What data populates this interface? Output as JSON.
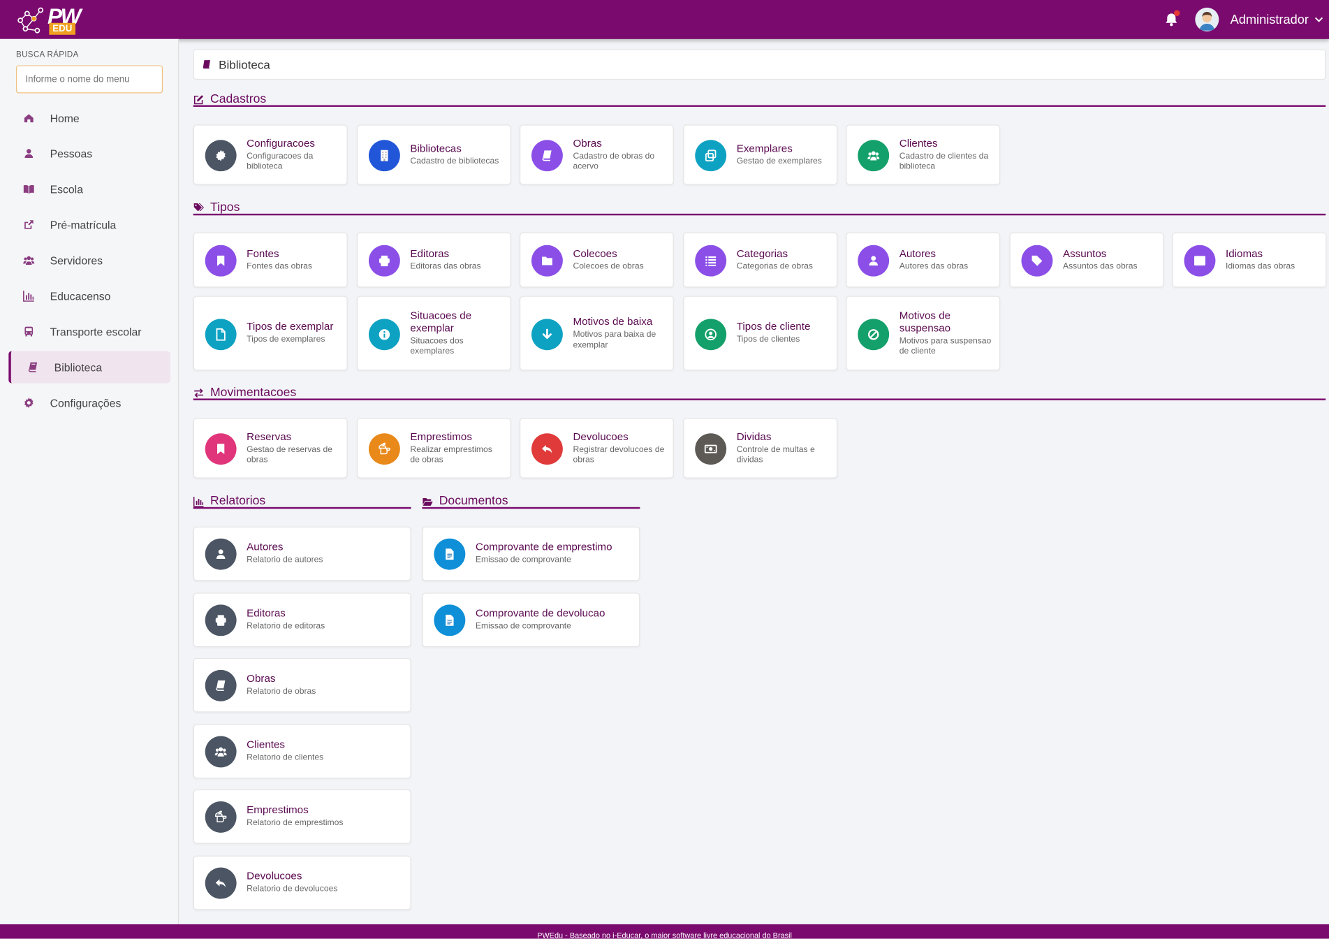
{
  "brand": {
    "name": "PW",
    "badge": "EDU"
  },
  "header": {
    "user": "Administrador"
  },
  "sidebar": {
    "busca_label": "BUSCA RÁPIDA",
    "busca_placeholder": "Informe o nome do menu",
    "items": [
      {
        "label": "Home",
        "icon": "home-icon"
      },
      {
        "label": "Pessoas",
        "icon": "person-icon"
      },
      {
        "label": "Escola",
        "icon": "book-open-icon"
      },
      {
        "label": "Pré-matrícula",
        "icon": "external-link-icon"
      },
      {
        "label": "Servidores",
        "icon": "users-icon"
      },
      {
        "label": "Educacenso",
        "icon": "bar-chart-icon"
      },
      {
        "label": "Transporte escolar",
        "icon": "bus-icon"
      },
      {
        "label": "Biblioteca",
        "icon": "book-icon",
        "active": true
      },
      {
        "label": "Configurações",
        "icon": "gear-icon"
      }
    ]
  },
  "breadcrumb": {
    "title": "Biblioteca"
  },
  "sections": {
    "cadastros": {
      "title": "Cadastros",
      "icon": "edit-icon",
      "cards": [
        {
          "title": "Configuracoes",
          "desc": "Configuracoes da biblioteca",
          "color": "#4b5563",
          "icon": "gear-icon"
        },
        {
          "title": "Bibliotecas",
          "desc": "Cadastro de bibliotecas",
          "color": "#2256d8",
          "icon": "building-icon"
        },
        {
          "title": "Obras",
          "desc": "Cadastro de obras do acervo",
          "color": "#8b4fe8",
          "icon": "book-icon"
        },
        {
          "title": "Exemplares",
          "desc": "Gestao de exemplares",
          "color": "#0ea2c2",
          "icon": "copy-icon"
        },
        {
          "title": "Clientes",
          "desc": "Cadastro de clientes da biblioteca",
          "color": "#14a06a",
          "icon": "users-icon"
        }
      ]
    },
    "tipos": {
      "title": "Tipos",
      "icon": "tags-icon",
      "cards": [
        {
          "title": "Fontes",
          "desc": "Fontes das obras",
          "color": "#8b4fe8",
          "icon": "bookmark-icon"
        },
        {
          "title": "Editoras",
          "desc": "Editoras das obras",
          "color": "#8b4fe8",
          "icon": "printer-icon"
        },
        {
          "title": "Colecoes",
          "desc": "Colecoes de obras",
          "color": "#8b4fe8",
          "icon": "folder-icon"
        },
        {
          "title": "Categorias",
          "desc": "Categorias de obras",
          "color": "#8b4fe8",
          "icon": "list-icon"
        },
        {
          "title": "Autores",
          "desc": "Autores das obras",
          "color": "#8b4fe8",
          "icon": "person-icon"
        },
        {
          "title": "Assuntos",
          "desc": "Assuntos das obras",
          "color": "#8b4fe8",
          "icon": "tag-icon"
        },
        {
          "title": "Idiomas",
          "desc": "Idiomas das obras",
          "color": "#8b4fe8",
          "icon": "language-icon"
        },
        {
          "title": "Tipos de exemplar",
          "desc": "Tipos de exemplares",
          "color": "#0ea2c2",
          "icon": "file-icon"
        },
        {
          "title": "Situacoes de exemplar",
          "desc": "Situacoes dos exemplares",
          "color": "#0ea2c2",
          "icon": "info-icon"
        },
        {
          "title": "Motivos de baixa",
          "desc": "Motivos para baixa de exemplar",
          "color": "#0ea2c2",
          "icon": "arrow-down-icon"
        },
        {
          "title": "Tipos de cliente",
          "desc": "Tipos de clientes",
          "color": "#14a06a",
          "icon": "user-circle-icon"
        },
        {
          "title": "Motivos de suspensao",
          "desc": "Motivos para suspensao de cliente",
          "color": "#14a06a",
          "icon": "ban-icon"
        }
      ]
    },
    "movimentacoes": {
      "title": "Movimentacoes",
      "icon": "exchange-icon",
      "cards": [
        {
          "title": "Reservas",
          "desc": "Gestao de reservas de obras",
          "color": "#e0357a",
          "icon": "bookmark-icon"
        },
        {
          "title": "Emprestimos",
          "desc": "Realizar emprestimos de obras",
          "color": "#e8891a",
          "icon": "hand-point-icon"
        },
        {
          "title": "Devolucoes",
          "desc": "Registrar devolucoes de obras",
          "color": "#e03a3a",
          "icon": "reply-icon"
        },
        {
          "title": "Dividas",
          "desc": "Controle de multas e dividas",
          "color": "#5d5954",
          "icon": "money-icon"
        }
      ]
    },
    "relatorios": {
      "title": "Relatorios",
      "icon": "bar-chart-icon",
      "cards": [
        {
          "title": "Autores",
          "desc": "Relatorio de autores",
          "color": "#4b5563",
          "icon": "person-icon"
        },
        {
          "title": "Editoras",
          "desc": "Relatorio de editoras",
          "color": "#4b5563",
          "icon": "printer-icon"
        },
        {
          "title": "Obras",
          "desc": "Relatorio de obras",
          "color": "#4b5563",
          "icon": "book-icon"
        },
        {
          "title": "Clientes",
          "desc": "Relatorio de clientes",
          "color": "#4b5563",
          "icon": "users-icon"
        },
        {
          "title": "Emprestimos",
          "desc": "Relatorio de emprestimos",
          "color": "#4b5563",
          "icon": "hand-point-icon"
        },
        {
          "title": "Devolucoes",
          "desc": "Relatorio de devolucoes",
          "color": "#4b5563",
          "icon": "reply-icon"
        }
      ]
    },
    "documentos": {
      "title": "Documentos",
      "icon": "folder-open-icon",
      "cards": [
        {
          "title": "Comprovante de emprestimo",
          "desc": "Emissao de comprovante",
          "color": "#0e8fd8",
          "icon": "file-text-icon"
        },
        {
          "title": "Comprovante de devolucao",
          "desc": "Emissao de comprovante",
          "color": "#0e8fd8",
          "icon": "file-text-icon"
        }
      ]
    }
  },
  "footer": {
    "text": "PWEdu - Baseado no i-Educar, o maior software livre educacional do Brasil"
  }
}
